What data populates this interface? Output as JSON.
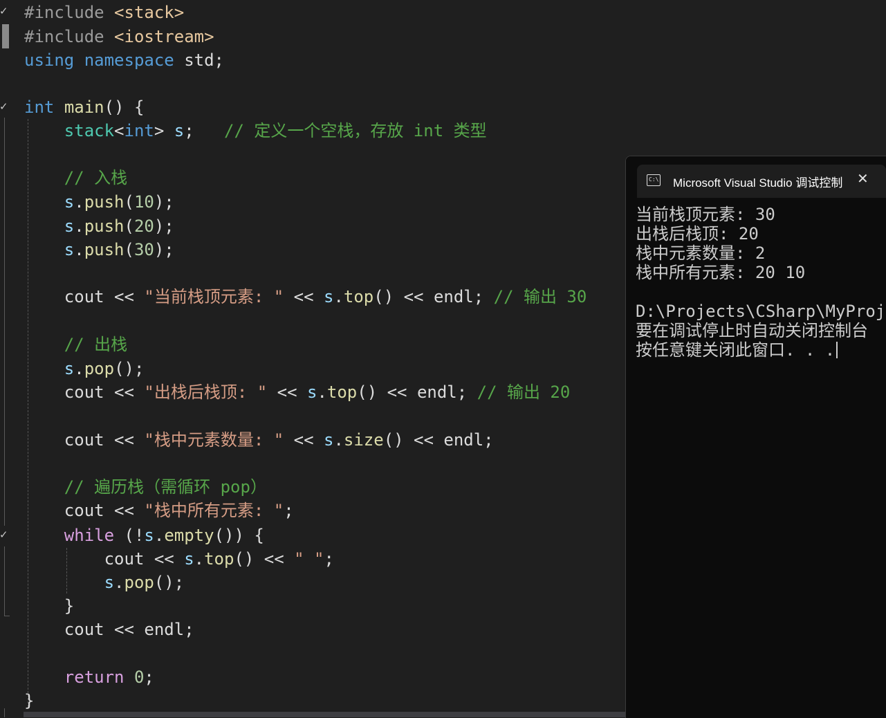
{
  "editor": {
    "lines": [
      {
        "tokens": [
          {
            "t": "#include ",
            "c": "pp"
          },
          {
            "t": "<stack>",
            "c": "inc"
          }
        ]
      },
      {
        "tokens": [
          {
            "t": "#include ",
            "c": "pp"
          },
          {
            "t": "<iostream>",
            "c": "inc"
          }
        ]
      },
      {
        "tokens": [
          {
            "t": "using",
            "c": "kw"
          },
          {
            "t": " ",
            "c": "def"
          },
          {
            "t": "namespace",
            "c": "kw"
          },
          {
            "t": " std;",
            "c": "def"
          }
        ]
      },
      {
        "tokens": []
      },
      {
        "tokens": [
          {
            "t": "int",
            "c": "kw"
          },
          {
            "t": " ",
            "c": "def"
          },
          {
            "t": "main",
            "c": "fn"
          },
          {
            "t": "() {",
            "c": "def"
          }
        ]
      },
      {
        "tokens": [
          {
            "t": "    ",
            "c": "def"
          },
          {
            "t": "stack",
            "c": "ty"
          },
          {
            "t": "<",
            "c": "def"
          },
          {
            "t": "int",
            "c": "kw"
          },
          {
            "t": "> ",
            "c": "def"
          },
          {
            "t": "s",
            "c": "var"
          },
          {
            "t": ";   ",
            "c": "def"
          },
          {
            "t": "// 定义一个空栈，存放 int 类型",
            "c": "com"
          }
        ]
      },
      {
        "tokens": []
      },
      {
        "tokens": [
          {
            "t": "    ",
            "c": "def"
          },
          {
            "t": "// 入栈",
            "c": "com"
          }
        ]
      },
      {
        "tokens": [
          {
            "t": "    ",
            "c": "def"
          },
          {
            "t": "s",
            "c": "var"
          },
          {
            "t": ".",
            "c": "def"
          },
          {
            "t": "push",
            "c": "fn"
          },
          {
            "t": "(",
            "c": "def"
          },
          {
            "t": "10",
            "c": "num"
          },
          {
            "t": ");",
            "c": "def"
          }
        ]
      },
      {
        "tokens": [
          {
            "t": "    ",
            "c": "def"
          },
          {
            "t": "s",
            "c": "var"
          },
          {
            "t": ".",
            "c": "def"
          },
          {
            "t": "push",
            "c": "fn"
          },
          {
            "t": "(",
            "c": "def"
          },
          {
            "t": "20",
            "c": "num"
          },
          {
            "t": ");",
            "c": "def"
          }
        ]
      },
      {
        "tokens": [
          {
            "t": "    ",
            "c": "def"
          },
          {
            "t": "s",
            "c": "var"
          },
          {
            "t": ".",
            "c": "def"
          },
          {
            "t": "push",
            "c": "fn"
          },
          {
            "t": "(",
            "c": "def"
          },
          {
            "t": "30",
            "c": "num"
          },
          {
            "t": ");",
            "c": "def"
          }
        ]
      },
      {
        "tokens": []
      },
      {
        "tokens": [
          {
            "t": "    cout << ",
            "c": "def"
          },
          {
            "t": "\"当前栈顶元素: \"",
            "c": "str"
          },
          {
            "t": " << ",
            "c": "def"
          },
          {
            "t": "s",
            "c": "var"
          },
          {
            "t": ".",
            "c": "def"
          },
          {
            "t": "top",
            "c": "fn"
          },
          {
            "t": "() << endl; ",
            "c": "def"
          },
          {
            "t": "// 输出 30",
            "c": "com"
          }
        ]
      },
      {
        "tokens": []
      },
      {
        "tokens": [
          {
            "t": "    ",
            "c": "def"
          },
          {
            "t": "// 出栈",
            "c": "com"
          }
        ]
      },
      {
        "tokens": [
          {
            "t": "    ",
            "c": "def"
          },
          {
            "t": "s",
            "c": "var"
          },
          {
            "t": ".",
            "c": "def"
          },
          {
            "t": "pop",
            "c": "fn"
          },
          {
            "t": "();",
            "c": "def"
          }
        ]
      },
      {
        "tokens": [
          {
            "t": "    cout << ",
            "c": "def"
          },
          {
            "t": "\"出栈后栈顶: \"",
            "c": "str"
          },
          {
            "t": " << ",
            "c": "def"
          },
          {
            "t": "s",
            "c": "var"
          },
          {
            "t": ".",
            "c": "def"
          },
          {
            "t": "top",
            "c": "fn"
          },
          {
            "t": "() << endl; ",
            "c": "def"
          },
          {
            "t": "// 输出 20",
            "c": "com"
          }
        ]
      },
      {
        "tokens": []
      },
      {
        "tokens": [
          {
            "t": "    cout << ",
            "c": "def"
          },
          {
            "t": "\"栈中元素数量: \"",
            "c": "str"
          },
          {
            "t": " << ",
            "c": "def"
          },
          {
            "t": "s",
            "c": "var"
          },
          {
            "t": ".",
            "c": "def"
          },
          {
            "t": "size",
            "c": "fn"
          },
          {
            "t": "() << endl;",
            "c": "def"
          }
        ]
      },
      {
        "tokens": []
      },
      {
        "tokens": [
          {
            "t": "    ",
            "c": "def"
          },
          {
            "t": "// 遍历栈（需循环 pop）",
            "c": "com"
          }
        ]
      },
      {
        "tokens": [
          {
            "t": "    cout << ",
            "c": "def"
          },
          {
            "t": "\"栈中所有元素: \"",
            "c": "str"
          },
          {
            "t": ";",
            "c": "def"
          }
        ]
      },
      {
        "tokens": [
          {
            "t": "    ",
            "c": "def"
          },
          {
            "t": "while",
            "c": "kw2"
          },
          {
            "t": " (!",
            "c": "def"
          },
          {
            "t": "s",
            "c": "var"
          },
          {
            "t": ".",
            "c": "def"
          },
          {
            "t": "empty",
            "c": "fn"
          },
          {
            "t": "()) {",
            "c": "def"
          }
        ]
      },
      {
        "tokens": [
          {
            "t": "        cout << ",
            "c": "def"
          },
          {
            "t": "s",
            "c": "var"
          },
          {
            "t": ".",
            "c": "def"
          },
          {
            "t": "top",
            "c": "fn"
          },
          {
            "t": "() << ",
            "c": "def"
          },
          {
            "t": "\" \"",
            "c": "str"
          },
          {
            "t": ";",
            "c": "def"
          }
        ]
      },
      {
        "tokens": [
          {
            "t": "        ",
            "c": "def"
          },
          {
            "t": "s",
            "c": "var"
          },
          {
            "t": ".",
            "c": "def"
          },
          {
            "t": "pop",
            "c": "fn"
          },
          {
            "t": "();",
            "c": "def"
          }
        ]
      },
      {
        "tokens": [
          {
            "t": "    }",
            "c": "def"
          }
        ]
      },
      {
        "tokens": [
          {
            "t": "    cout << endl;",
            "c": "def"
          }
        ]
      },
      {
        "tokens": []
      },
      {
        "tokens": [
          {
            "t": "    ",
            "c": "def"
          },
          {
            "t": "return",
            "c": "kw2"
          },
          {
            "t": " ",
            "c": "def"
          },
          {
            "t": "0",
            "c": "num"
          },
          {
            "t": ";",
            "c": "def"
          }
        ]
      },
      {
        "tokens": [
          {
            "t": "}",
            "c": "def"
          }
        ]
      }
    ]
  },
  "console": {
    "title": "Microsoft Visual Studio 调试控制台",
    "icon": "console-app-icon",
    "close_icon": "close-icon",
    "output_lines": [
      "当前栈顶元素: 30",
      "出栈后栈顶: 20",
      "栈中元素数量: 2",
      "栈中所有元素: 20 10",
      "",
      "D:\\Projects\\CSharp\\MyProject",
      "要在调试停止时自动关闭控制台",
      "按任意键关闭此窗口. . ."
    ]
  }
}
